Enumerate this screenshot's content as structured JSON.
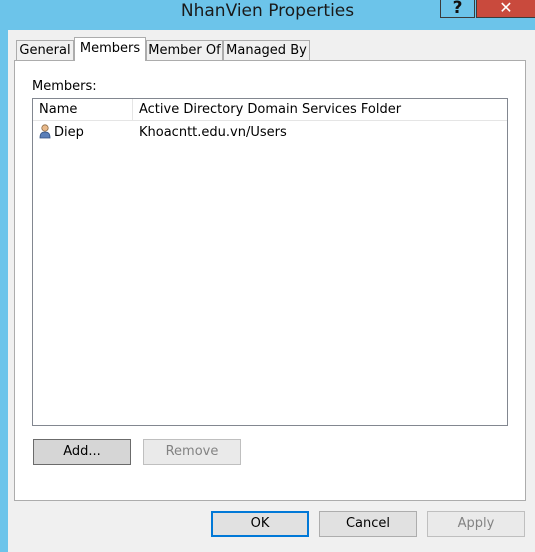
{
  "window": {
    "title": "NhanVien Properties",
    "help_glyph": "?",
    "close_glyph": "✕"
  },
  "tabs": [
    {
      "label": "General"
    },
    {
      "label": "Members",
      "active": true
    },
    {
      "label": "Member Of"
    },
    {
      "label": "Managed By"
    }
  ],
  "members_panel": {
    "label": "Members:",
    "columns": [
      "Name",
      "Active Directory Domain Services Folder"
    ],
    "rows": [
      {
        "name": "Diep",
        "folder": "Khoacntt.edu.vn/Users",
        "icon": "user-icon"
      }
    ],
    "add_label": "Add...",
    "remove_label": "Remove"
  },
  "footer": {
    "ok_label": "OK",
    "cancel_label": "Cancel",
    "apply_label": "Apply"
  }
}
